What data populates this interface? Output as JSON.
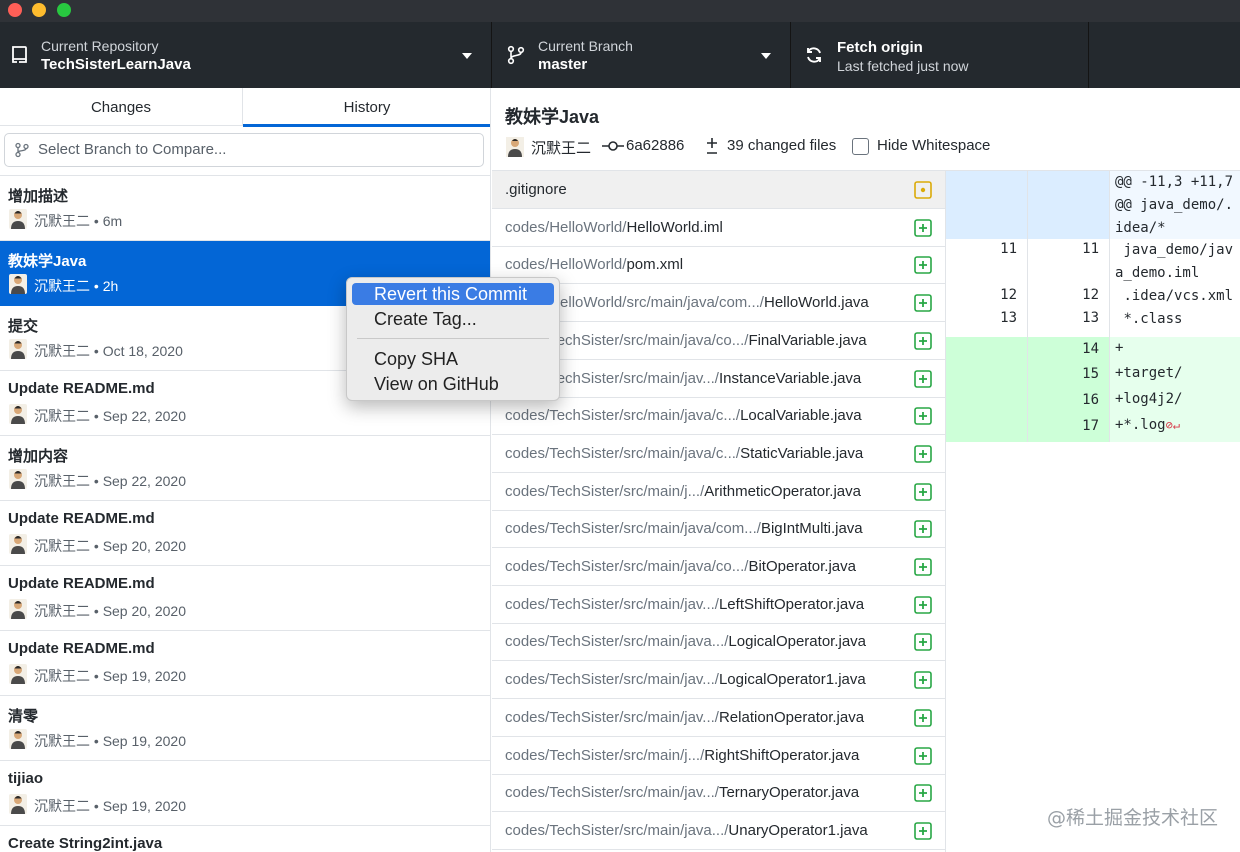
{
  "toolbar": {
    "repo_label": "Current Repository",
    "repo_name": "TechSisterLearnJava",
    "branch_label": "Current Branch",
    "branch_name": "master",
    "fetch_title": "Fetch origin",
    "fetch_sub": "Last fetched just now"
  },
  "tabs": {
    "changes": "Changes",
    "history": "History"
  },
  "compare": {
    "placeholder": "Select Branch to Compare..."
  },
  "commits": [
    {
      "title": "增加描述",
      "author": "沉默王二",
      "time": "6m"
    },
    {
      "title": "教妹学Java",
      "author": "沉默王二",
      "time": "2h"
    },
    {
      "title": "提交",
      "author": "沉默王二",
      "time": "Oct 18, 2020"
    },
    {
      "title": "Update README.md",
      "author": "沉默王二",
      "time": "Sep 22, 2020"
    },
    {
      "title": "增加内容",
      "author": "沉默王二",
      "time": "Sep 22, 2020"
    },
    {
      "title": "Update README.md",
      "author": "沉默王二",
      "time": "Sep 20, 2020"
    },
    {
      "title": "Update README.md",
      "author": "沉默王二",
      "time": "Sep 20, 2020"
    },
    {
      "title": "Update README.md",
      "author": "沉默王二",
      "time": "Sep 19, 2020"
    },
    {
      "title": "清零",
      "author": "沉默王二",
      "time": "Sep 19, 2020"
    },
    {
      "title": "tijiao",
      "author": "沉默王二",
      "time": "Sep 19, 2020"
    },
    {
      "title": "Create String2int.java",
      "author": "",
      "time": ""
    }
  ],
  "context_menu": {
    "revert": "Revert this Commit",
    "tag": "Create Tag...",
    "copy_sha": "Copy SHA",
    "view_github": "View on GitHub"
  },
  "detail": {
    "title": "教妹学Java",
    "author": "沉默王二",
    "sha": "6a62886",
    "changed": "39 changed files",
    "hide_ws": "Hide Whitespace"
  },
  "files": [
    {
      "dir": "",
      "name": ".gitignore",
      "status": "modified"
    },
    {
      "dir": "codes/HelloWorld/",
      "name": "HelloWorld.iml",
      "status": "added"
    },
    {
      "dir": "codes/HelloWorld/",
      "name": "pom.xml",
      "status": "added"
    },
    {
      "dir": "codes/HelloWorld/src/main/java/com.../",
      "name": "HelloWorld.java",
      "status": "added"
    },
    {
      "dir": "codes/TechSister/src/main/java/co.../",
      "name": "FinalVariable.java",
      "status": "added"
    },
    {
      "dir": "codes/TechSister/src/main/jav.../",
      "name": "InstanceVariable.java",
      "status": "added"
    },
    {
      "dir": "codes/TechSister/src/main/java/c.../",
      "name": "LocalVariable.java",
      "status": "added"
    },
    {
      "dir": "codes/TechSister/src/main/java/c.../",
      "name": "StaticVariable.java",
      "status": "added"
    },
    {
      "dir": "codes/TechSister/src/main/j.../",
      "name": "ArithmeticOperator.java",
      "status": "added"
    },
    {
      "dir": "codes/TechSister/src/main/java/com.../",
      "name": "BigIntMulti.java",
      "status": "added"
    },
    {
      "dir": "codes/TechSister/src/main/java/co.../",
      "name": "BitOperator.java",
      "status": "added"
    },
    {
      "dir": "codes/TechSister/src/main/jav.../",
      "name": "LeftShiftOperator.java",
      "status": "added"
    },
    {
      "dir": "codes/TechSister/src/main/java.../",
      "name": "LogicalOperator.java",
      "status": "added"
    },
    {
      "dir": "codes/TechSister/src/main/jav.../",
      "name": "LogicalOperator1.java",
      "status": "added"
    },
    {
      "dir": "codes/TechSister/src/main/jav.../",
      "name": "RelationOperator.java",
      "status": "added"
    },
    {
      "dir": "codes/TechSister/src/main/j.../",
      "name": "RightShiftOperator.java",
      "status": "added"
    },
    {
      "dir": "codes/TechSister/src/main/jav.../",
      "name": "TernaryOperator.java",
      "status": "added"
    },
    {
      "dir": "codes/TechSister/src/main/java.../",
      "name": "UnaryOperator1.java",
      "status": "added"
    }
  ],
  "diff": [
    {
      "kind": "hunk",
      "old": "",
      "new": "",
      "text": "@@ -11,3 +11,7 @@ java_demo/.idea/*"
    },
    {
      "kind": "ctx",
      "old": "11",
      "new": "11",
      "text": " java_demo/java_demo.iml"
    },
    {
      "kind": "ctx",
      "old": "12",
      "new": "12",
      "text": " .idea/vcs.xml"
    },
    {
      "kind": "ctx",
      "old": "13",
      "new": "13",
      "text": " *.class"
    },
    {
      "kind": "add",
      "old": "",
      "new": "14",
      "text": "+"
    },
    {
      "kind": "add",
      "old": "",
      "new": "15",
      "text": "+target/"
    },
    {
      "kind": "add",
      "old": "",
      "new": "16",
      "text": "+log4j2/"
    },
    {
      "kind": "add",
      "old": "",
      "new": "17",
      "text": "+*.log"
    }
  ],
  "watermark": "@稀土掘金技术社区",
  "colors": {
    "accent": "#0366d6",
    "toolbar": "#24292e",
    "added": "#28a745",
    "modified": "#dbab09"
  },
  "icons": {
    "repo": "repo-icon",
    "branch": "git-branch-icon",
    "sync": "sync-icon",
    "commit": "git-commit-icon",
    "diff": "diff-icon",
    "added": "file-added-icon",
    "modified": "file-modified-icon",
    "no_newline": "no-newline-icon"
  }
}
